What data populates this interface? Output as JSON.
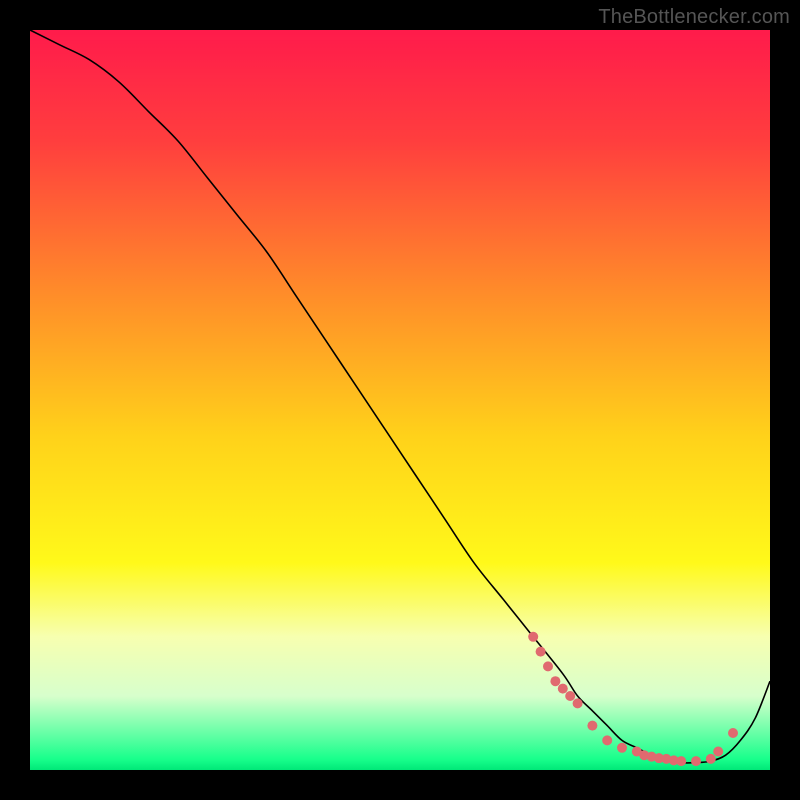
{
  "watermark": {
    "text": "TheBottlenecker.com"
  },
  "chart_data": {
    "type": "line",
    "title": "",
    "xlabel": "",
    "ylabel": "",
    "xlim": [
      0,
      100
    ],
    "ylim": [
      0,
      100
    ],
    "background_gradient": {
      "direction": "top-to-bottom",
      "stops": [
        {
          "pos": 0.0,
          "color": "#ff1b4b"
        },
        {
          "pos": 0.15,
          "color": "#ff3e3e"
        },
        {
          "pos": 0.35,
          "color": "#ff8a2a"
        },
        {
          "pos": 0.55,
          "color": "#ffd21a"
        },
        {
          "pos": 0.72,
          "color": "#fff91a"
        },
        {
          "pos": 0.82,
          "color": "#f7ffb0"
        },
        {
          "pos": 0.9,
          "color": "#d7ffcc"
        },
        {
          "pos": 0.985,
          "color": "#19ff8c"
        },
        {
          "pos": 1.0,
          "color": "#00e878"
        }
      ]
    },
    "series": [
      {
        "name": "bottleneck-curve",
        "type": "line",
        "color": "#000000",
        "stroke_width": 1.6,
        "x": [
          0,
          4,
          8,
          12,
          16,
          20,
          24,
          28,
          32,
          36,
          40,
          44,
          48,
          52,
          56,
          60,
          64,
          68,
          72,
          74,
          76,
          78,
          80,
          82,
          84,
          86,
          88,
          90,
          92,
          94,
          96,
          98,
          100
        ],
        "y": [
          100,
          98,
          96,
          93,
          89,
          85,
          80,
          75,
          70,
          64,
          58,
          52,
          46,
          40,
          34,
          28,
          23,
          18,
          13,
          10,
          8,
          6,
          4,
          3,
          2,
          1.5,
          1,
          1,
          1.2,
          2,
          4,
          7,
          12
        ]
      },
      {
        "name": "highlight-points",
        "type": "scatter",
        "color": "#e06a6f",
        "radius": 5,
        "x": [
          68,
          69,
          70,
          71,
          72,
          73,
          74,
          76,
          78,
          80,
          82,
          83,
          84,
          85,
          86,
          87,
          88,
          90,
          92,
          93,
          95
        ],
        "y": [
          18,
          16,
          14,
          12,
          11,
          10,
          9,
          6,
          4,
          3,
          2.5,
          2,
          1.8,
          1.6,
          1.5,
          1.3,
          1.2,
          1.2,
          1.5,
          2.5,
          5
        ]
      }
    ]
  }
}
